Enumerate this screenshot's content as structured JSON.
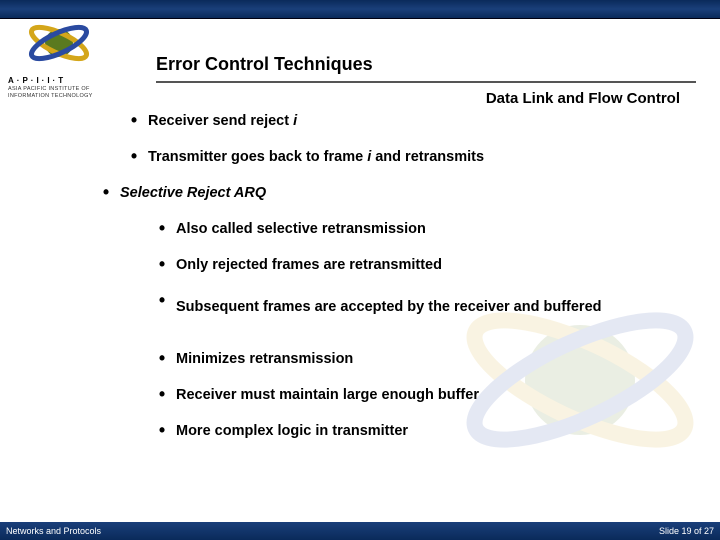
{
  "header": {
    "title": "Error Control Techniques",
    "subtitle": "Data Link and Flow Control"
  },
  "logo": {
    "line1": "A·P·I·I·T",
    "line2": "ASIA PACIFIC INSTITUTE OF",
    "line3": "INFORMATION TECHNOLOGY"
  },
  "bullets": {
    "b1_pre": "Receiver send reject ",
    "b1_ital": "i",
    "b2_pre": "Transmitter goes back to frame ",
    "b2_ital": "i",
    "b2_post": " and retransmits",
    "b3": "Selective Reject  ARQ",
    "b4": "Also called selective retransmission",
    "b5": "Only rejected frames are retransmitted",
    "b6": "Subsequent frames are accepted by the receiver and buffered",
    "b7": "Minimizes retransmission",
    "b8": "Receiver must maintain large enough buffer",
    "b9": "More complex logic in transmitter"
  },
  "footer": {
    "left": "Networks and Protocols",
    "right": "Slide 19 of 27"
  }
}
